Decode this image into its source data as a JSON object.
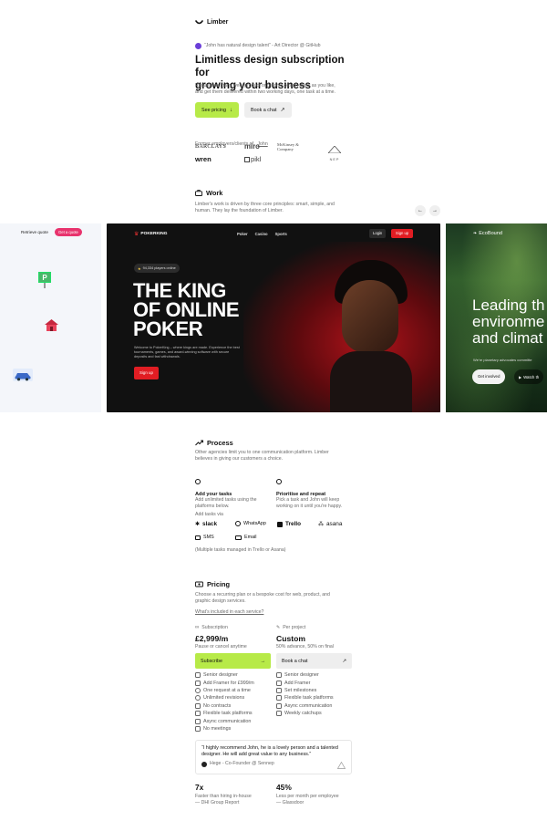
{
  "brand": {
    "name": "Limber"
  },
  "hero": {
    "quote": "“John has natural design talent” - Art Director @ GitHub",
    "quote_name": "John",
    "title_line1": "Limitless design subscription for",
    "title_line2": "growing your business",
    "desc_line1": "Request as many web, product or graphic design tasks as you like,",
    "desc_line2": "and get them delivered within two working days, one task at a time.",
    "see_pricing": "See pricing",
    "book_chat": "Book a chat"
  },
  "clients": {
    "label_prefix": "Former employers/clients of",
    "label_name": "John",
    "logos": [
      "BARCLAYS",
      "miro",
      "McKinsey & Company",
      "NEP",
      "wren",
      "pikl"
    ]
  },
  "work": {
    "title": "Work",
    "desc_line1": "Limber's work is driven by three core principles: smart, simple, and",
    "desc_line2": "human. They lay the foundation of Limber."
  },
  "carousel": {
    "left": {
      "retrieve": "Retrieve quote",
      "get_quote": "Get a quote"
    },
    "center": {
      "brand": "POKERKING",
      "nav": [
        "Poker",
        "Casino",
        "Sports"
      ],
      "login": "Login",
      "signup_top": "Sign up",
      "badge": "94,334 players online",
      "headline1": "THE KING",
      "headline2": "OF ONLINE",
      "headline3": "POKER",
      "body1": "Welcome to PokerKing – where kings are made. Experience the best",
      "body2": "tournaments, games, and award-winning software with secure",
      "body3": "deposits and fast withdrawals.",
      "signup": "Sign up"
    },
    "right": {
      "brand": "EcoBound",
      "h1": "Leading th",
      "h2": "environme",
      "h3": "and climat",
      "sub": "We're planetary advocates committe",
      "get_involved": "Get involved",
      "watch": "Watch th"
    }
  },
  "process": {
    "title": "Process",
    "desc_line1": "Other agencies limit you to one communication platform. Limber",
    "desc_line2": "believes in giving our customers a choice.",
    "step1_title": "Add your tasks",
    "step1_l1": "Add unlimited tasks using the",
    "step1_l2": "platforms below.",
    "step2_title": "Prioritise and repeat",
    "step2_l1": "Pick a task and John will keep",
    "step2_l2": "working on it until you're happy.",
    "add_via": "Add tasks via",
    "tools": [
      "slack",
      "WhatsApp",
      "Trello",
      "asana",
      "SMS",
      "Email"
    ],
    "note": "(Multiple tasks managed in Trello or Asana)"
  },
  "pricing": {
    "title": "Pricing",
    "desc_line1": "Choose a recurring plan or a bespoke cost for web, product, and",
    "desc_line2": "graphic design services.",
    "whats_included": "What's included in each service?",
    "sub_label": "Subscription",
    "sub_price": "£2,999/m",
    "sub_note": "Pause or cancel anytime",
    "sub_btn": "Subscribe",
    "proj_label": "Per project",
    "proj_price": "Custom",
    "proj_note": "50% advance, 50% on final",
    "proj_btn": "Book a chat",
    "sub_features": [
      "Senior designer",
      "Add Framer for £999/m",
      "One request at a time",
      "Unlimited revisions",
      "No contracts",
      "Flexible task platforms",
      "Async communication",
      "No meetings"
    ],
    "proj_features": [
      "Senior designer",
      "Add Framer",
      "Set milestones",
      "Flexible task platforms",
      "Async communication",
      "Weekly catchups"
    ]
  },
  "testimonial": {
    "quote_l1": "“I highly recommend John, he is a lovely person and a talented",
    "quote_l2": "designer. He will add great value to any business.”",
    "author": "Hege - Co-Founder @ Sennep"
  },
  "stats": [
    {
      "value": "7x",
      "l1": "Faster than hiring in-house",
      "l2": "— DHI Group Report"
    },
    {
      "value": "45%",
      "l1": "Less per month per employee",
      "l2": "— Glassdoor"
    }
  ]
}
